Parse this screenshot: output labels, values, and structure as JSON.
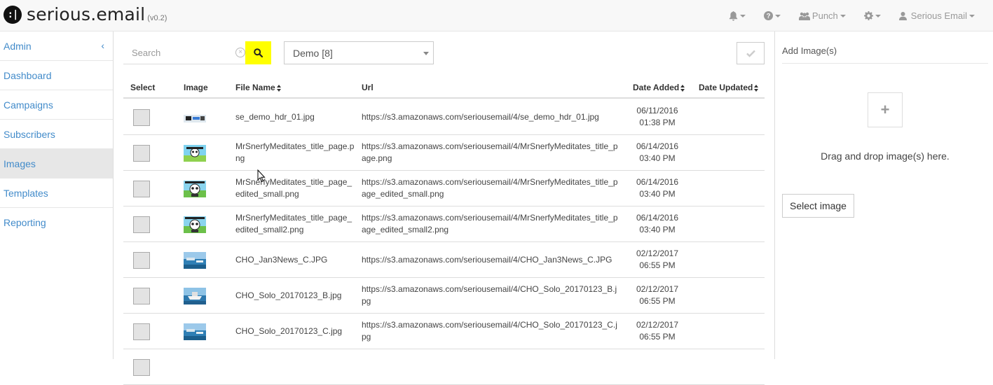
{
  "brand": {
    "logo": ":|",
    "name": "serious.email",
    "version": "(v0.2)"
  },
  "topnav": {
    "bell_icon": "bell-icon",
    "help_icon": "question-circle-icon",
    "org_label": "Punch",
    "settings_icon": "gear-icon",
    "user_label": "Serious Email"
  },
  "sidebar": {
    "items": [
      {
        "label": "Admin"
      },
      {
        "label": "Dashboard"
      },
      {
        "label": "Campaigns"
      },
      {
        "label": "Subscribers"
      },
      {
        "label": "Images"
      },
      {
        "label": "Templates"
      },
      {
        "label": "Reporting"
      }
    ],
    "collapse_icon": "‹"
  },
  "search": {
    "placeholder": "Search",
    "clear_icon": "×"
  },
  "list_select": {
    "value": "Demo [8]"
  },
  "table": {
    "headers": {
      "select": "Select",
      "image": "Image",
      "file_name": "File Name",
      "url": "Url",
      "date_added": "Date Added",
      "date_updated": "Date Updated"
    },
    "rows": [
      {
        "file_name": "se_demo_hdr_01.jpg",
        "url": "https://s3.amazonaws.com/seriousemail/4/se_demo_hdr_01.jpg",
        "date": "06/11/2016",
        "time": "01:38 PM",
        "thumb": "banner"
      },
      {
        "file_name": "MrSnerfyMeditates_title_page.png",
        "url": "https://s3.amazonaws.com/seriousemail/4/MrSnerfyMeditates_title_page.png",
        "date": "06/14/2016",
        "time": "03:40 PM",
        "thumb": "cartoon1"
      },
      {
        "file_name": "MrSnerfyMeditates_title_page_edited_small.png",
        "url": "https://s3.amazonaws.com/seriousemail/4/MrSnerfyMeditates_title_page_edited_small.png",
        "date": "06/14/2016",
        "time": "03:40 PM",
        "thumb": "cartoon2"
      },
      {
        "file_name": "MrSnerfyMeditates_title_page_edited_small2.png",
        "url": "https://s3.amazonaws.com/seriousemail/4/MrSnerfyMeditates_title_page_edited_small2.png",
        "date": "06/14/2016",
        "time": "03:40 PM",
        "thumb": "cartoon2"
      },
      {
        "file_name": "CHO_Jan3News_C.JPG",
        "url": "https://s3.amazonaws.com/seriousemail/4/CHO_Jan3News_C.JPG",
        "date": "02/12/2017",
        "time": "06:55 PM",
        "thumb": "sea"
      },
      {
        "file_name": "CHO_Solo_20170123_B.jpg",
        "url": "https://s3.amazonaws.com/seriousemail/4/CHO_Solo_20170123_B.jpg",
        "date": "02/12/2017",
        "time": "06:55 PM",
        "thumb": "boat"
      },
      {
        "file_name": "CHO_Solo_20170123_C.jpg",
        "url": "https://s3.amazonaws.com/seriousemail/4/CHO_Solo_20170123_C.jpg",
        "date": "02/12/2017",
        "time": "06:55 PM",
        "thumb": "sea"
      }
    ]
  },
  "right_panel": {
    "title": "Add Image(s)",
    "plus": "+",
    "drop_text": "Drag and drop image(s) here.",
    "select_button": "Select image"
  },
  "colors": {
    "accent": "#428bca",
    "search_button": "#ffff00",
    "active_bg": "#e7e7e7"
  }
}
